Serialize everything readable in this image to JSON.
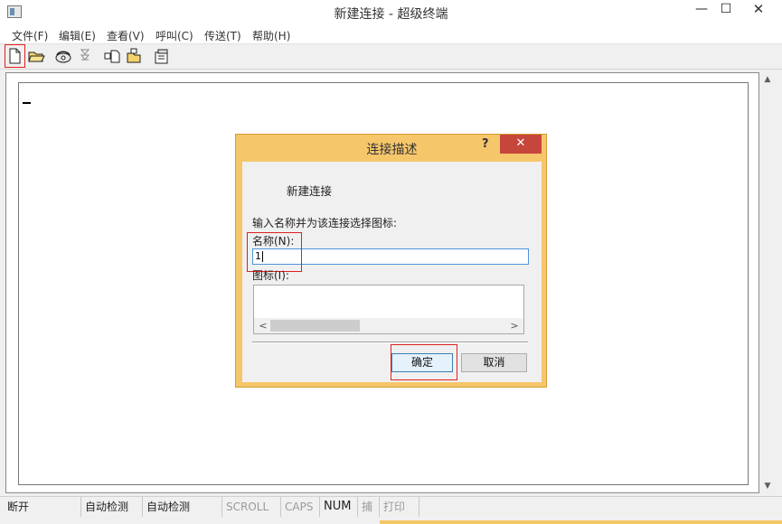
{
  "window": {
    "title": "新建连接 - 超级终端",
    "minimize_glyph": "—",
    "maximize_glyph": "☐",
    "close_glyph": "✕"
  },
  "menu": {
    "items": [
      {
        "label": "文件(F)"
      },
      {
        "label": "编辑(E)"
      },
      {
        "label": "查看(V)"
      },
      {
        "label": "呼叫(C)"
      },
      {
        "label": "传送(T)"
      },
      {
        "label": "帮助(H)"
      }
    ]
  },
  "toolbar": {
    "icons": [
      "new-file-icon",
      "open-folder-icon",
      "phone-dial-icon",
      "phone-hangup-icon",
      "send-file-icon",
      "receive-file-icon",
      "properties-icon"
    ]
  },
  "dialog": {
    "title": "连接描述",
    "help_glyph": "?",
    "close_glyph": "✕",
    "heading": "新建连接",
    "prompt": "输入名称并为该连接选择图标:",
    "name_label": "名称(N):",
    "name_value": "1",
    "icon_label": "图标(I):",
    "scroll_left": "<",
    "scroll_right": ">",
    "ok_label": "确定",
    "cancel_label": "取消"
  },
  "scrollbar": {
    "up_glyph": "▲",
    "down_glyph": "▼"
  },
  "status": {
    "connection": "断开",
    "detect1": "自动检测",
    "detect2": "自动检测",
    "scroll": "SCROLL",
    "caps": "CAPS",
    "num": "NUM",
    "capture": "捕",
    "print": "打印"
  },
  "colors": {
    "dialog_frame": "#f6c66b",
    "close_red": "#c7463c",
    "highlight_red": "#e02020",
    "focus_blue": "#4d93d9"
  }
}
